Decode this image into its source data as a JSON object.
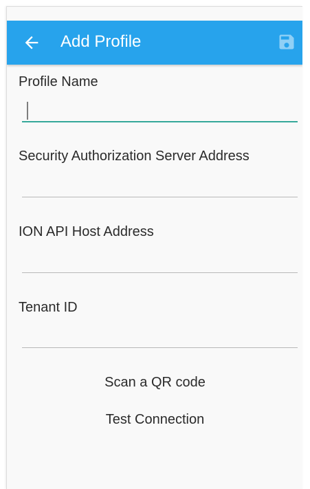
{
  "header": {
    "title": "Add Profile",
    "back_icon": "arrow-back-icon",
    "save_icon": "save-floppy-icon",
    "color": "#27a3ec"
  },
  "form": {
    "profile_name_label": "Profile Name",
    "profile_name_value": "",
    "security_server_label": "Security Authorization Server Address",
    "security_server_value": "",
    "ion_api_label": "ION API Host Address",
    "ion_api_value": "",
    "tenant_id_label": "Tenant ID",
    "tenant_id_value": ""
  },
  "actions": {
    "scan_qr_label": "Scan a QR code",
    "test_connection_label": "Test Connection"
  },
  "colors": {
    "active_underline": "#35a89a",
    "inactive_underline": "#b8b8b8"
  }
}
